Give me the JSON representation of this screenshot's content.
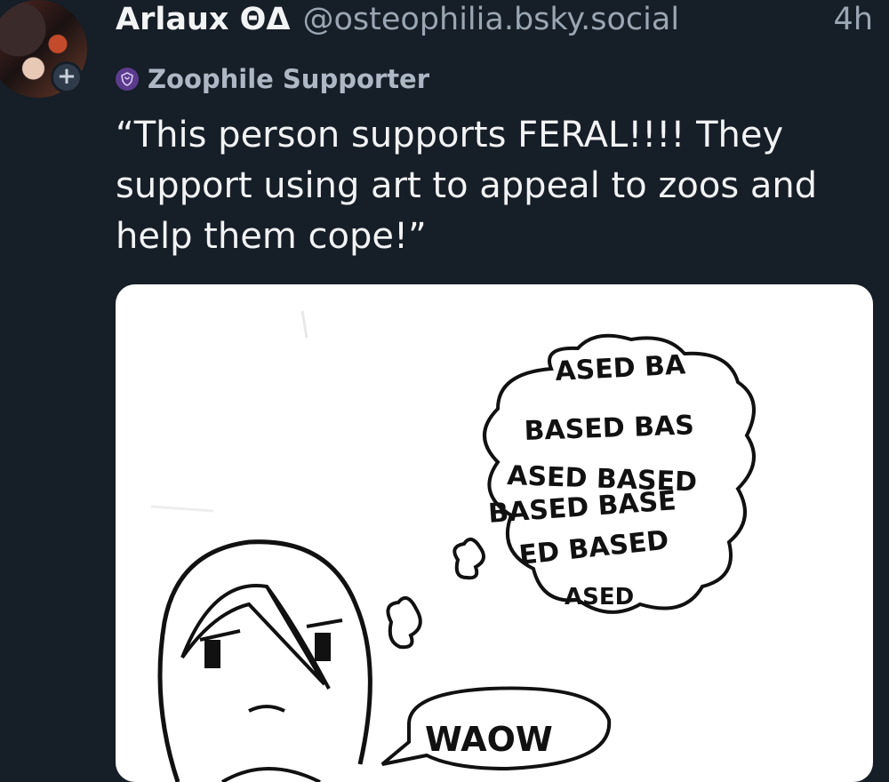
{
  "post": {
    "display_name": "Arlaux ΘΔ",
    "handle": "@osteophilia.bsky.social",
    "time": "4h",
    "label": "Zoophile Supporter",
    "text": "“This person supports FERAL!!!! They support using art to appeal to zoos and help them cope!”"
  },
  "image": {
    "thought_lines": [
      "ASED BA",
      "BASED BAS",
      "ASED BASED",
      "BASED BASE",
      "ED BASED",
      "ASED"
    ],
    "speech": "WAOW"
  },
  "icons": {
    "follow": "plus-icon",
    "label": "label-shield-icon"
  },
  "colors": {
    "background": "#161e27",
    "text": "#f1f3f5",
    "muted": "#9aa6b2",
    "label_badge": "#5b3b8c"
  }
}
